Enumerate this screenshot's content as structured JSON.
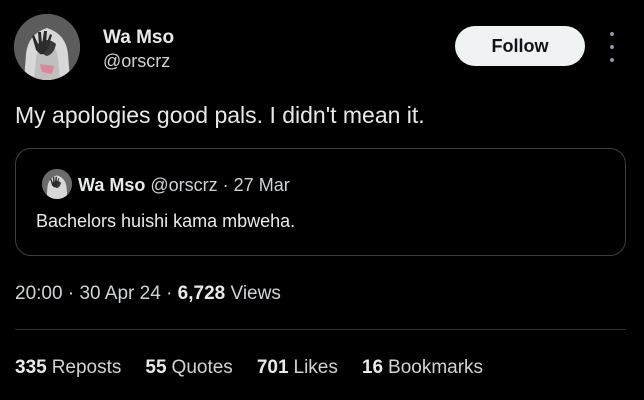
{
  "author": {
    "name": "Wa Mso",
    "handle": "@orscrz",
    "avatar_icon": "profile-avatar-hooded-figure"
  },
  "follow_label": "Follow",
  "more_icon": "more-options-icon",
  "tweet_text": "My apologies good pals. I didn't mean it.",
  "quoted": {
    "name": "Wa Mso",
    "handle": "@orscrz",
    "separator": "·",
    "date": "27 Mar",
    "text": "Bachelors huishi kama mbweha."
  },
  "meta": {
    "time": "20:00",
    "sep1": "·",
    "date": "30 Apr 24",
    "sep2": "·",
    "views_count": "6,728",
    "views_label": "Views"
  },
  "stats": {
    "reposts_count": "335",
    "reposts_label": "Reposts",
    "quotes_count": "55",
    "quotes_label": "Quotes",
    "likes_count": "701",
    "likes_label": "Likes",
    "bookmarks_count": "16",
    "bookmarks_label": "Bookmarks"
  },
  "colors": {
    "background": "#000000",
    "text": "#e7e9ea",
    "secondary": "#cfd3d6",
    "follow_bg": "#eff3f4",
    "border": "#2f3336"
  }
}
